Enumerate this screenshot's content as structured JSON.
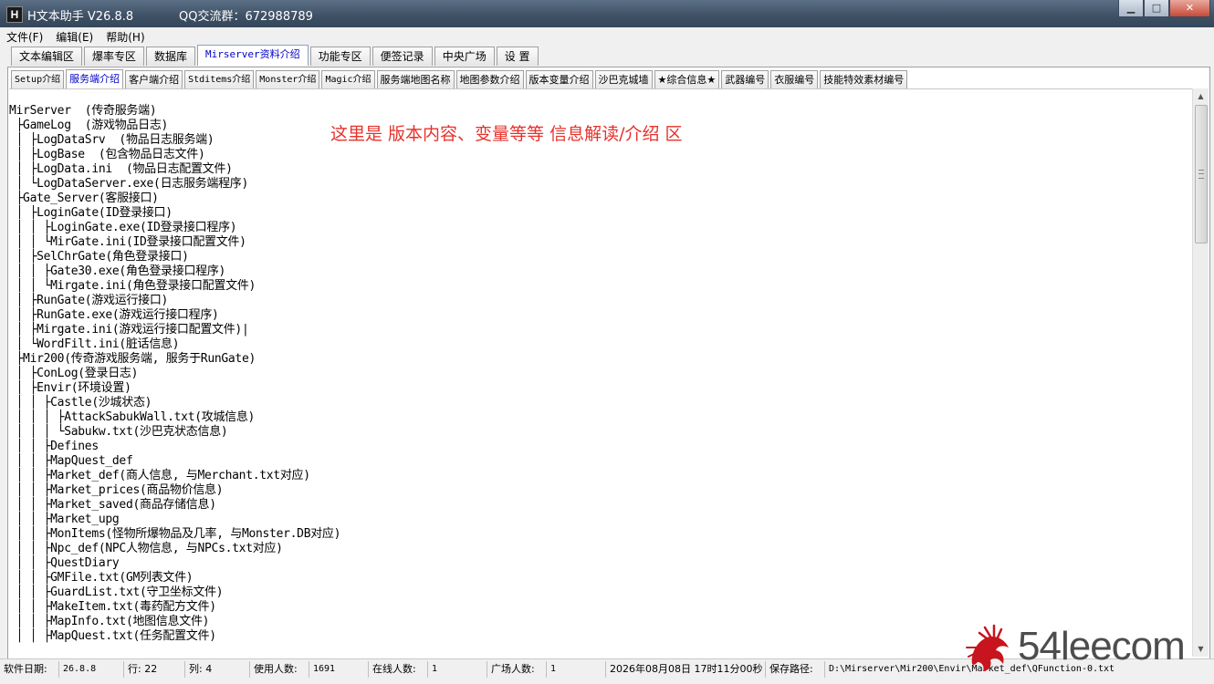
{
  "window": {
    "title": "H文本助手  V26.8.8",
    "qq_group": "QQ交流群：672988789",
    "app_icon_letter": "H",
    "minimize_glyph": "▁",
    "maximize_glyph": "□",
    "close_glyph": "✕"
  },
  "menu": [
    "文件(F)",
    "编辑(E)",
    "帮助(H)"
  ],
  "main_tabs": [
    {
      "label": "文本编辑区",
      "active": false
    },
    {
      "label": "爆率专区",
      "active": false
    },
    {
      "label": "数据库",
      "active": false
    },
    {
      "label": "Mirserver资料介绍",
      "active": true
    },
    {
      "label": "功能专区",
      "active": false
    },
    {
      "label": "便签记录",
      "active": false
    },
    {
      "label": "中央广场",
      "active": false
    },
    {
      "label": "设  置",
      "active": false
    }
  ],
  "sub_tabs": [
    {
      "label": "Setup介绍",
      "active": false,
      "mono": true
    },
    {
      "label": "服务端介绍",
      "active": true,
      "mono": false
    },
    {
      "label": "客户端介绍",
      "active": false,
      "mono": false
    },
    {
      "label": "Stditems介绍",
      "active": false,
      "mono": true
    },
    {
      "label": "Monster介绍",
      "active": false,
      "mono": true
    },
    {
      "label": "Magic介绍",
      "active": false,
      "mono": true
    },
    {
      "label": "服务端地图名称",
      "active": false,
      "mono": false
    },
    {
      "label": "地图参数介绍",
      "active": false,
      "mono": false
    },
    {
      "label": "版本变量介绍",
      "active": false,
      "mono": false
    },
    {
      "label": "沙巴克城墙",
      "active": false,
      "mono": false
    },
    {
      "label": "★综合信息★",
      "active": false,
      "mono": false
    },
    {
      "label": "武器编号",
      "active": false,
      "mono": false
    },
    {
      "label": "衣服编号",
      "active": false,
      "mono": false
    },
    {
      "label": "技能特效素材编号",
      "active": false,
      "mono": false
    }
  ],
  "annotation": "这里是 版本内容、变量等等  信息解读/介绍 区",
  "tree_lines": [
    "MirServer  (传奇服务端)",
    " ├GameLog  (游戏物品日志)",
    " │ ├LogDataSrv  (物品日志服务端)",
    " │ ├LogBase  (包含物品日志文件)",
    " │ ├LogData.ini  (物品日志配置文件)",
    " │ └LogDataServer.exe(日志服务端程序)",
    " ├Gate_Server(客服接口)",
    " │ ├LoginGate(ID登录接口)",
    " │ │ ├LoginGate.exe(ID登录接口程序)",
    " │ │ └MirGate.ini(ID登录接口配置文件)",
    " │ ├SelChrGate(角色登录接口)",
    " │ │ ├Gate30.exe(角色登录接口程序)",
    " │ │ └Mirgate.ini(角色登录接口配置文件)",
    " │ ├RunGate(游戏运行接口)",
    " │ ├RunGate.exe(游戏运行接口程序)",
    " │ ├Mirgate.ini(游戏运行接口配置文件)|",
    " │ └WordFilt.ini(脏话信息)",
    " ├Mir200(传奇游戏服务端, 服务于RunGate)",
    " │ ├ConLog(登录日志)",
    " │ ├Envir(环境设置)",
    " │ │ ├Castle(沙城状态)",
    " │ │ │ ├AttackSabukWall.txt(攻城信息)",
    " │ │ │ └Sabukw.txt(沙巴克状态信息)",
    " │ │ ├Defines",
    " │ │ ├MapQuest_def",
    " │ │ ├Market_def(商人信息, 与Merchant.txt对应)",
    " │ │ ├Market_prices(商品物价信息)",
    " │ │ ├Market_saved(商品存储信息)",
    " │ │ ├Market_upg",
    " │ │ ├MonItems(怪物所爆物品及几率, 与Monster.DB对应)",
    " │ │ ├Npc_def(NPC人物信息, 与NPCs.txt对应)",
    " │ │ ├QuestDiary",
    " │ │ ├GMFile.txt(GM列表文件)",
    " │ │ ├GuardList.txt(守卫坐标文件)",
    " │ │ ├MakeItem.txt(毒药配方文件)",
    " │ │ ├MapInfo.txt(地图信息文件)",
    " │ │ ├MapQuest.txt(任务配置文件)"
  ],
  "status": {
    "date_label": "软件日期:",
    "date_value": "26.8.8",
    "row": "行: 22",
    "col": "列: 4",
    "users_label": "使用人数:",
    "users_value": "1691",
    "online_label": "在线人数:",
    "online_value": "1",
    "plaza_label": "广场人数:",
    "plaza_value": "1",
    "datetime": "2026年08月08日 17时11分00秒",
    "save_label": "保存路径:",
    "save_path": "D:\\Mirserver\\Mir200\\Envir\\Market_def\\QFunction-0.txt"
  },
  "watermark": {
    "text": "54leecom",
    "color": "#4d4d4d",
    "logo_color": "#c8141e"
  },
  "colors": {
    "annotation": "#e6322b",
    "active_tab_text": "#0000c8"
  }
}
